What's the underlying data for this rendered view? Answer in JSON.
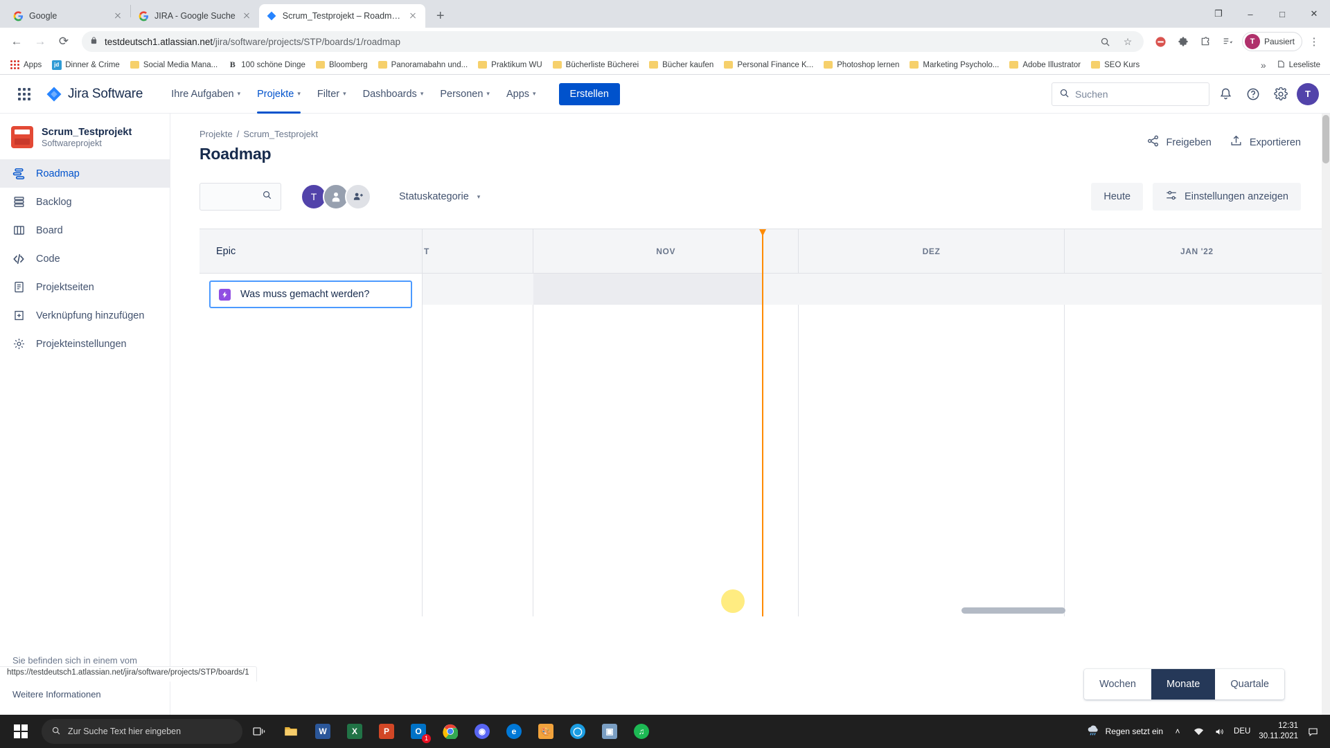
{
  "browser": {
    "tabs": [
      {
        "title": "Google",
        "favicon": "google-icon",
        "active": false
      },
      {
        "title": "JIRA - Google Suche",
        "favicon": "google-icon",
        "active": false
      },
      {
        "title": "Scrum_Testprojekt – Roadmap -",
        "favicon": "jira-icon",
        "active": true
      }
    ],
    "new_tab_label": "+",
    "window_controls": {
      "minimize": "–",
      "maximize": "□",
      "close": "✕",
      "restore": "❐"
    },
    "nav": {
      "back": "←",
      "forward": "→",
      "reload": "⟳"
    },
    "omnibox": {
      "lock": "🔒",
      "url_host": "testdeutsch1.atlassian.net",
      "url_path": "/jira/software/projects/STP/boards/1/roadmap",
      "zoom_icon": "search-zoom-icon",
      "star_icon": "☆"
    },
    "profile": {
      "avatar_letter": "T",
      "label": "Pausiert"
    },
    "extensions_icon": "puzzle-icon",
    "bookmarks": [
      {
        "label": "Apps",
        "icon": "apps-grid"
      },
      {
        "label": "Dinner & Crime",
        "icon": "jd-icon"
      },
      {
        "label": "Social Media Mana...",
        "icon": "folder"
      },
      {
        "label": "100 schöne Dinge",
        "icon": "b-icon"
      },
      {
        "label": "Bloomberg",
        "icon": "folder"
      },
      {
        "label": "Panoramabahn und...",
        "icon": "folder"
      },
      {
        "label": "Praktikum WU",
        "icon": "folder"
      },
      {
        "label": "Bücherliste Bücherei",
        "icon": "folder"
      },
      {
        "label": "Bücher kaufen",
        "icon": "folder"
      },
      {
        "label": "Personal Finance K...",
        "icon": "folder"
      },
      {
        "label": "Photoshop lernen",
        "icon": "folder"
      },
      {
        "label": "Marketing Psycholo...",
        "icon": "folder"
      },
      {
        "label": "Adobe Illustrator",
        "icon": "folder"
      },
      {
        "label": "SEO Kurs",
        "icon": "folder"
      }
    ],
    "bookmarks_overflow": "»",
    "reading_list": "Leseliste",
    "status_bar_url": "https://testdeutsch1.atlassian.net/jira/software/projects/STP/boards/1"
  },
  "jira": {
    "product_name": "Jira Software",
    "waffle_label": "app-switcher",
    "nav_items": [
      {
        "label": "Ihre Aufgaben",
        "has_caret": true,
        "active": false
      },
      {
        "label": "Projekte",
        "has_caret": true,
        "active": true
      },
      {
        "label": "Filter",
        "has_caret": true,
        "active": false
      },
      {
        "label": "Dashboards",
        "has_caret": true,
        "active": false
      },
      {
        "label": "Personen",
        "has_caret": true,
        "active": false
      },
      {
        "label": "Apps",
        "has_caret": true,
        "active": false
      }
    ],
    "create_button": "Erstellen",
    "search_placeholder": "Suchen",
    "nav_avatar_letter": "T",
    "accent_color": "#0052cc"
  },
  "sidebar": {
    "project_name": "Scrum_Testprojekt",
    "project_type": "Softwareprojekt",
    "items": [
      {
        "label": "Roadmap",
        "icon": "roadmap-icon",
        "active": true
      },
      {
        "label": "Backlog",
        "icon": "backlog-icon",
        "active": false
      },
      {
        "label": "Board",
        "icon": "board-icon",
        "active": false
      },
      {
        "label": "Code",
        "icon": "code-icon",
        "active": false
      },
      {
        "label": "Projektseiten",
        "icon": "pages-icon",
        "active": false
      },
      {
        "label": "Verknüpfung hinzufügen",
        "icon": "add-link-icon",
        "active": false
      },
      {
        "label": "Projekteinstellungen",
        "icon": "settings-icon",
        "active": false
      }
    ],
    "footer_note": "Sie befinden sich in einem vom Team verwalteten Projekt",
    "footer_link": "Weitere Informationen"
  },
  "main": {
    "breadcrumb": [
      "Projekte",
      "Scrum_Testprojekt"
    ],
    "breadcrumb_separator": "/",
    "page_title": "Roadmap",
    "header_actions": [
      {
        "label": "Freigeben",
        "icon": "share-icon"
      },
      {
        "label": "Exportieren",
        "icon": "export-icon"
      }
    ],
    "toolbar": {
      "search_value": "",
      "search_icon": "search-icon",
      "avatars": [
        {
          "letter": "T",
          "kind": "user"
        },
        {
          "letter": "",
          "kind": "anonymous"
        },
        {
          "letter": "",
          "kind": "add-people"
        }
      ],
      "status_category_label": "Statuskategorie",
      "today_button": "Heute",
      "settings_button": "Einstellungen anzeigen"
    },
    "timeline": {
      "epic_column_header": "Epic",
      "months": [
        "T",
        "NOV",
        "DEZ",
        "JAN '22"
      ],
      "epic_placeholder": "Was muss gemacht werden?",
      "epic_badge_icon": "epic-icon",
      "today_marker_color": "#ff8b00"
    },
    "view_switch": {
      "options": [
        "Wochen",
        "Monate",
        "Quartale"
      ],
      "selected": "Monate"
    }
  },
  "taskbar": {
    "search_placeholder": "Zur Suche Text hier eingeben",
    "apps": [
      {
        "name": "task-view",
        "glyph": "❑",
        "color": "transparent"
      },
      {
        "name": "file-explorer",
        "glyph": "📁",
        "color": "#e8b339"
      },
      {
        "name": "word",
        "glyph": "W",
        "color": "#2b579a"
      },
      {
        "name": "excel",
        "glyph": "X",
        "color": "#217346"
      },
      {
        "name": "powerpoint",
        "glyph": "P",
        "color": "#d24726"
      },
      {
        "name": "outlook",
        "glyph": "✉",
        "color": "#0072c6",
        "badge": "1"
      },
      {
        "name": "chrome",
        "glyph": "●",
        "color": "#4285f4"
      },
      {
        "name": "discord",
        "glyph": "◑",
        "color": "#5865f2"
      },
      {
        "name": "edge-legacy",
        "glyph": "e",
        "color": "#0078d7"
      },
      {
        "name": "paint",
        "glyph": "🎨",
        "color": "#f2a33c"
      },
      {
        "name": "edge",
        "glyph": "◯",
        "color": "#1b9de2"
      },
      {
        "name": "photos",
        "glyph": "▣",
        "color": "#7a9ec2"
      },
      {
        "name": "spotify",
        "glyph": "♫",
        "color": "#1db954"
      }
    ],
    "tray": {
      "weather_icon": "rain-icon",
      "weather_text": "Regen setzt ein",
      "chevron": "˄",
      "network": "network-icon",
      "volume": "volume-icon",
      "language": "DEU",
      "time": "12:31",
      "date": "30.11.2021",
      "notification": "notification-icon"
    }
  }
}
